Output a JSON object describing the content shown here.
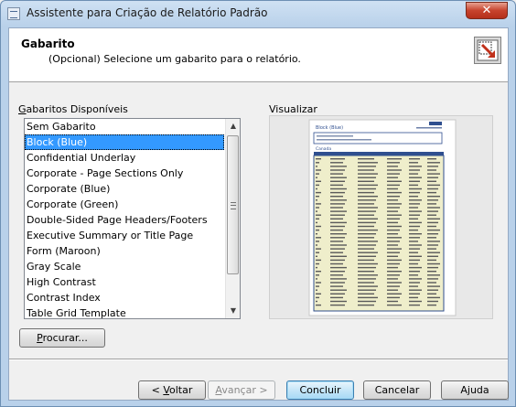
{
  "window": {
    "title": "Assistente para Criação de Relatório Padrão",
    "close_label": "✕"
  },
  "header": {
    "title": "Gabarito",
    "subtitle": "(Opcional) Selecione um gabarito para o relatório."
  },
  "templates": {
    "label_prefix": "G",
    "label_rest": "abaritos Disponíveis",
    "items": [
      "Sem Gabarito",
      "Block (Blue)",
      "Confidential Underlay",
      "Corporate - Page Sections Only",
      "Corporate (Blue)",
      "Corporate (Green)",
      "Double-Sided Page Headers/Footers",
      "Executive Summary or Title Page",
      "Form (Maroon)",
      "Gray Scale",
      "High Contrast",
      "Contrast Index",
      "Table Grid Template"
    ],
    "selected_index": 1
  },
  "browse": {
    "prefix": "P",
    "rest": "rocurar..."
  },
  "preview": {
    "label": "Visualizar",
    "doc_title": "Block (Blue)",
    "group_label": "Canada"
  },
  "footer": {
    "back_prefix": "< ",
    "back_u": "V",
    "back_rest": "oltar",
    "next_u": "A",
    "next_rest": "vançar >",
    "finish": "Concluir",
    "cancel": "Cancelar",
    "help": "Ajuda"
  },
  "colors": {
    "selection": "#3399ff",
    "preview_band": "#2f4f8f",
    "preview_row": "#efeecb"
  }
}
